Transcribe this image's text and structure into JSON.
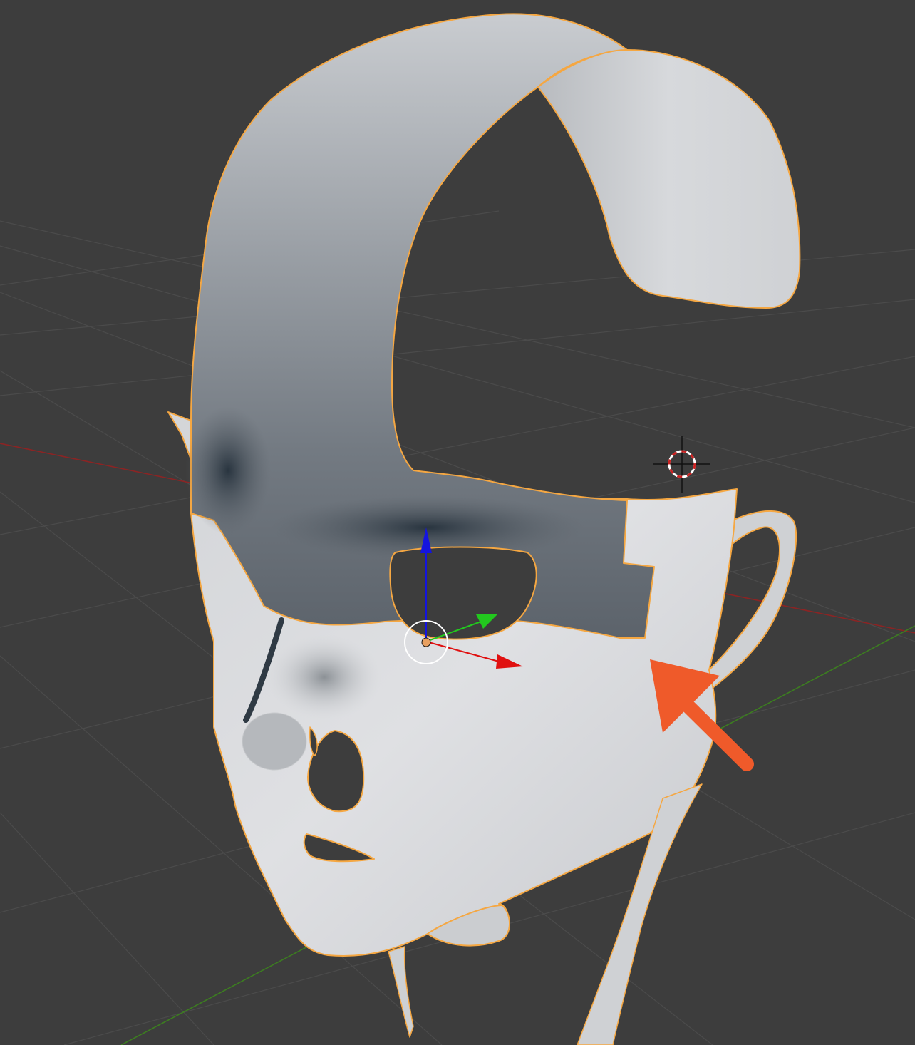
{
  "viewport": {
    "background": "#3d3d3d",
    "grid_color": "#4b4b4b",
    "x_axis_color": "#8b2424",
    "y_axis_color": "#3c7d20",
    "selection_outline_color": "#f5a742",
    "mesh_light_color": "#dcdde0",
    "mesh_dark_color": "#2c3640"
  },
  "gizmo": {
    "x_arrow_color": "#e01010",
    "y_arrow_color": "#22c81e",
    "z_arrow_color": "#1414e0",
    "origin_color": "#e8a060",
    "rotate_circle_color": "#ffffff"
  },
  "cursor_3d": {
    "ring_colors": [
      "#cc2222",
      "#ffffff"
    ],
    "crosshair_color": "#111111"
  },
  "annotation": {
    "arrow_color": "#ef5a2a",
    "points_to": "cheek-edge"
  },
  "icons": {
    "origin": "object-origin-icon",
    "cursor": "3d-cursor-icon",
    "gizmo": "transform-gizmo-icon"
  }
}
